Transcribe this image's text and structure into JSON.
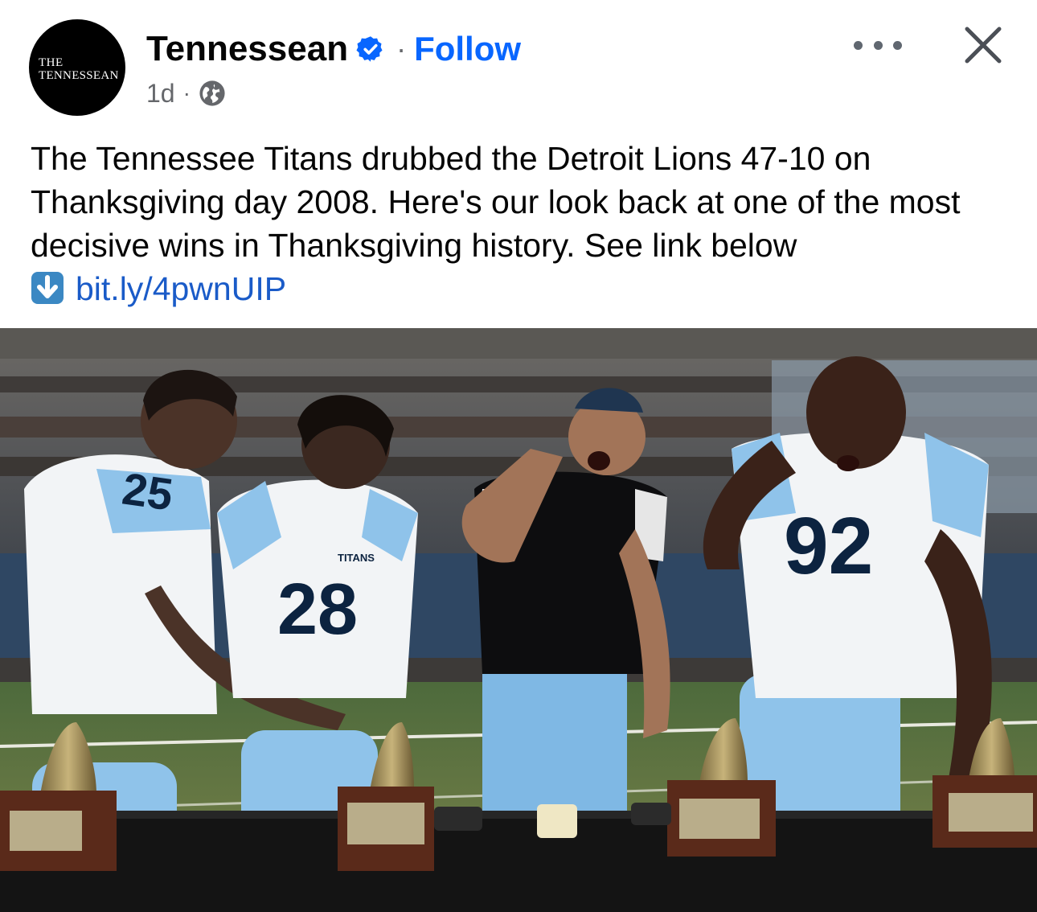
{
  "post": {
    "author": {
      "name": "Tennessean",
      "avatar_line1": "THE",
      "avatar_line2": "TENNESSEAN",
      "verified_icon": "verified-badge-icon"
    },
    "separator": "·",
    "follow_label": "Follow",
    "time": "1d",
    "meta_separator": "·",
    "audience_icon": "globe-icon",
    "more_icon": "more-options-icon",
    "close_icon": "close-icon",
    "text": "The Tennessee Titans drubbed the Detroit Lions 47-10 on Thanksgiving day 2008. Here's our look back at one of the most decisive wins in Thanksgiving history. See link below",
    "link_icon": "down-arrow-emoji-icon",
    "link": "bit.ly/4pwnUIP",
    "photo": {
      "jersey_numbers": [
        "25",
        "28",
        "92"
      ],
      "jersey_wordmark": "TITANS"
    }
  },
  "colors": {
    "text": "#050505",
    "secondary": "#65676b",
    "follow": "#0866ff",
    "link": "#1a5bc8",
    "verified": "#0866ff",
    "titans_light_blue": "#8fc3ea",
    "titans_navy": "#0c2340"
  }
}
